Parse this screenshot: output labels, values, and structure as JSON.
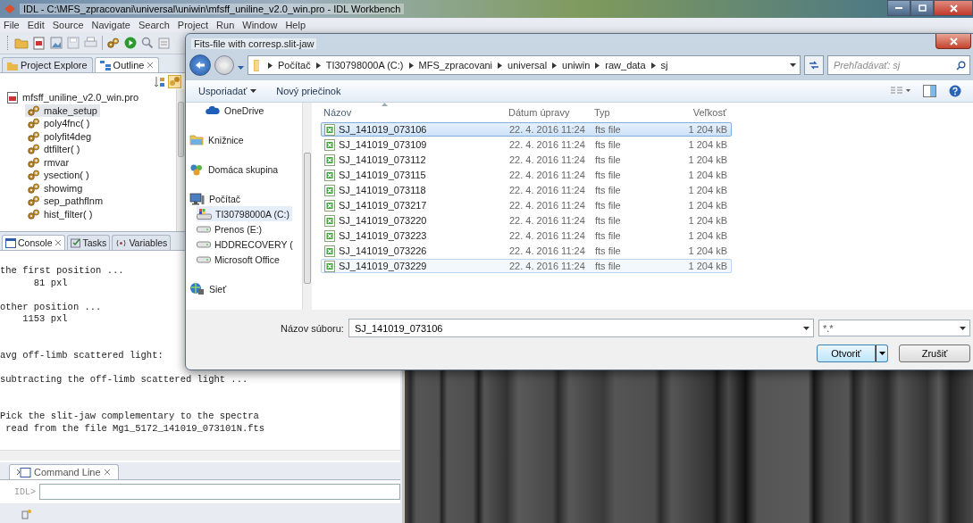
{
  "window": {
    "title": "IDL - C:\\MFS_zpracovani\\universal\\uniwin\\mfsff_uniline_v2.0_win.pro - IDL Workbench"
  },
  "menu": [
    "File",
    "Edit",
    "Source",
    "Navigate",
    "Search",
    "Project",
    "Run",
    "Window",
    "Help"
  ],
  "outline": {
    "tabs": [
      {
        "label": "Project Explore",
        "selected": false
      },
      {
        "label": "Outline",
        "selected": true
      }
    ],
    "tree": {
      "label": "mfsff_uniline_v2.0_win.pro",
      "children": [
        {
          "label": "make_setup",
          "selected": true
        },
        {
          "label": "poly4fnc( )",
          "selected": false
        },
        {
          "label": "polyfit4deg",
          "selected": false
        },
        {
          "label": "dtfilter( )",
          "selected": false
        },
        {
          "label": "rmvar",
          "selected": false
        },
        {
          "label": "ysection( )",
          "selected": false
        },
        {
          "label": "showimg",
          "selected": false
        },
        {
          "label": "sep_pathflnm",
          "selected": false
        },
        {
          "label": "hist_filter( )",
          "selected": false
        }
      ]
    }
  },
  "console": {
    "tabs": [
      {
        "label": "Console",
        "selected": true
      },
      {
        "label": "Tasks",
        "selected": false
      },
      {
        "label": "Variables",
        "selected": false
      }
    ],
    "output": "the first position ...\n      81 pxl\n\nother position ...\n    1153 pxl\n\n\navg off-limb scattered light:\n\nsubtracting the off-limb scattered light ...\n\n\nPick the slit-jaw complementary to the spectra\n read from the file Mg1_5172_141019_073101N.fts"
  },
  "command_line": {
    "tab": "Command Line",
    "prompt": "IDL>"
  },
  "dialog": {
    "title": "Fits-file with corresp.slit-jaw",
    "breadcrumb": [
      "Počítač",
      "TI30798000A (C:)",
      "MFS_zpracovani",
      "universal",
      "uniwin",
      "raw_data",
      "sj"
    ],
    "search": {
      "placeholder": "Prehľadávať: sj"
    },
    "toolbar": [
      "Usporiadať",
      "Nový priečinok"
    ],
    "nav": [
      {
        "label": "OneDrive",
        "kind": "cloud",
        "selected": false
      },
      {
        "label": "Knižnice",
        "kind": "library",
        "selected": false
      },
      {
        "label": "Domáca skupina",
        "kind": "homegroup",
        "selected": false
      },
      {
        "label": "Počítač",
        "kind": "computer",
        "selected": false,
        "children": [
          {
            "label": "TI30798000A (C:)",
            "kind": "system-drive",
            "selected": true
          },
          {
            "label": "Prenos (E:)",
            "kind": "drive",
            "selected": false
          },
          {
            "label": "HDDRECOVERY (",
            "kind": "drive",
            "selected": false
          },
          {
            "label": "Microsoft Office",
            "kind": "drive",
            "selected": false
          }
        ]
      },
      {
        "label": "Sieť",
        "kind": "network",
        "selected": false
      }
    ],
    "columns": [
      "Názov",
      "Dátum úpravy",
      "Typ",
      "Veľkosť"
    ],
    "rows": [
      {
        "name": "SJ_141019_073106",
        "date": "22. 4. 2016 11:24",
        "type": "fts file",
        "size": "1 204 kB",
        "selected": true,
        "hover": false
      },
      {
        "name": "SJ_141019_073109",
        "date": "22. 4. 2016 11:24",
        "type": "fts file",
        "size": "1 204 kB",
        "selected": false,
        "hover": false
      },
      {
        "name": "SJ_141019_073112",
        "date": "22. 4. 2016 11:24",
        "type": "fts file",
        "size": "1 204 kB",
        "selected": false,
        "hover": false
      },
      {
        "name": "SJ_141019_073115",
        "date": "22. 4. 2016 11:24",
        "type": "fts file",
        "size": "1 204 kB",
        "selected": false,
        "hover": false
      },
      {
        "name": "SJ_141019_073118",
        "date": "22. 4. 2016 11:24",
        "type": "fts file",
        "size": "1 204 kB",
        "selected": false,
        "hover": false
      },
      {
        "name": "SJ_141019_073217",
        "date": "22. 4. 2016 11:24",
        "type": "fts file",
        "size": "1 204 kB",
        "selected": false,
        "hover": false
      },
      {
        "name": "SJ_141019_073220",
        "date": "22. 4. 2016 11:24",
        "type": "fts file",
        "size": "1 204 kB",
        "selected": false,
        "hover": false
      },
      {
        "name": "SJ_141019_073223",
        "date": "22. 4. 2016 11:24",
        "type": "fts file",
        "size": "1 204 kB",
        "selected": false,
        "hover": false
      },
      {
        "name": "SJ_141019_073226",
        "date": "22. 4. 2016 11:24",
        "type": "fts file",
        "size": "1 204 kB",
        "selected": false,
        "hover": false
      },
      {
        "name": "SJ_141019_073229",
        "date": "22. 4. 2016 11:24",
        "type": "fts file",
        "size": "1 204 kB",
        "selected": false,
        "hover": true
      }
    ],
    "filename": {
      "label": "Názov súboru:",
      "value": "SJ_141019_073106"
    },
    "filter": {
      "value": "*.*"
    },
    "buttons": {
      "open": "Otvoriť",
      "cancel": "Zrušiť"
    }
  }
}
